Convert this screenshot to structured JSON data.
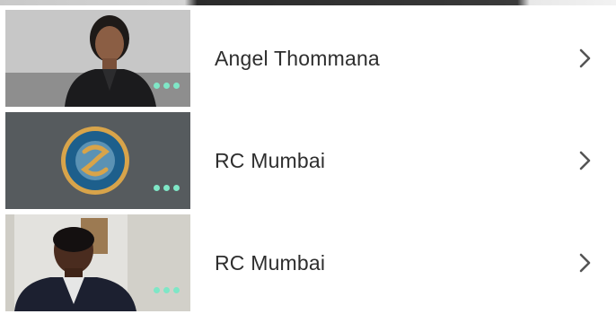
{
  "participants": [
    {
      "name": "Angel Thommana",
      "thumbnail": "woman-video-feed",
      "menu_icon": "more-dots-icon",
      "action_icon": "chevron-right-icon"
    },
    {
      "name": "RC Mumbai",
      "thumbnail": "circular-logo",
      "menu_icon": "more-dots-icon",
      "action_icon": "chevron-right-icon"
    },
    {
      "name": "RC Mumbai",
      "thumbnail": "man-video-feed",
      "menu_icon": "more-dots-icon",
      "action_icon": "chevron-right-icon"
    }
  ],
  "colors": {
    "dots": "#7fe6c6",
    "text": "#2e2e2e",
    "chevron": "#555555",
    "logo_ring": "#d8a44a",
    "logo_fill": "#1d5f8c"
  }
}
